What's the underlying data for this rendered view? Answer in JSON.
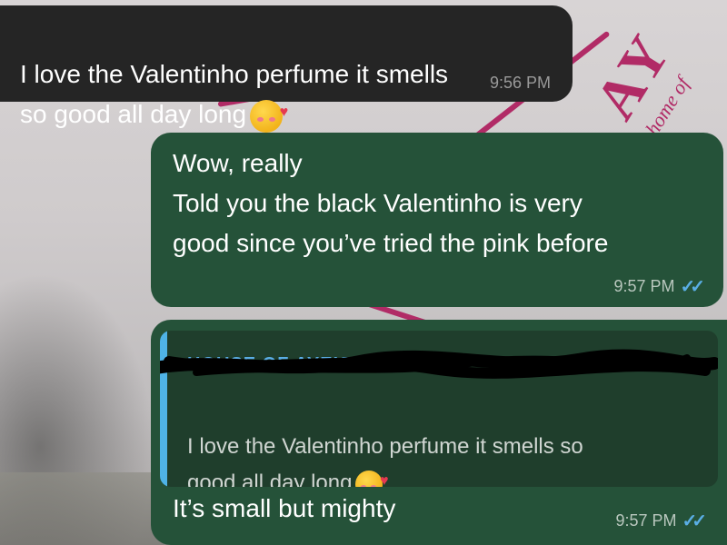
{
  "background": {
    "brand_mark": "AY",
    "brand_tagline": "home of"
  },
  "messages": [
    {
      "id": "m1",
      "direction": "incoming",
      "text": "I love the Valentinho perfume it smells\nso good all day long",
      "emoji": "smiling-face-with-hearts",
      "time": "9:56 PM"
    },
    {
      "id": "m2",
      "direction": "outgoing",
      "text": "Wow, really\nTold you the black Valentinho is very\ngood since you’ve tried the pink before",
      "time": "9:57 PM",
      "status": "read"
    },
    {
      "id": "m3",
      "direction": "outgoing",
      "reply_to": {
        "sender": "HOUSE OF AYEIS BEAUTY ...",
        "sender_redacted": true,
        "text": "I love the Valentinho perfume it smells so\ngood all day long",
        "emoji": "smiling-face-with-hearts"
      },
      "text": "It’s small but mighty",
      "time": "9:57 PM",
      "status": "read"
    }
  ],
  "colors": {
    "incoming_bubble": "#252525",
    "outgoing_bubble": "#255239",
    "reply_bar": "#4fb3e6",
    "read_ticks": "#5aaee5",
    "brand_pink": "#b12b66"
  }
}
